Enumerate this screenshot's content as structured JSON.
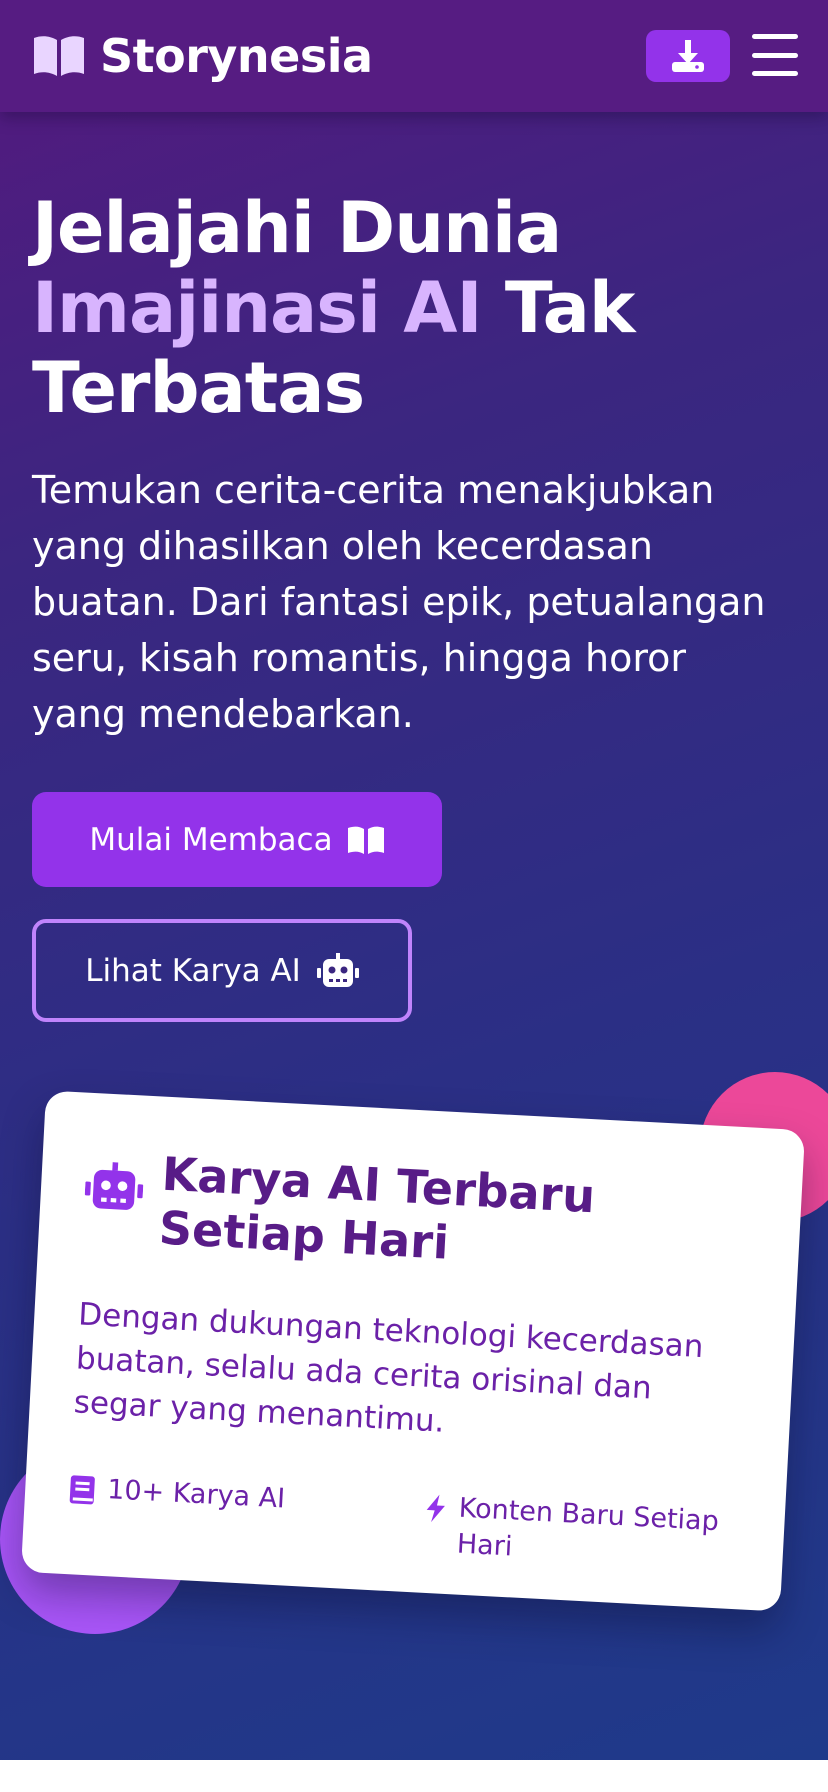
{
  "header": {
    "brand": "Storynesia",
    "logo_icon": "open-book-icon",
    "download_icon": "download-icon",
    "menu_icon": "hamburger-menu-icon"
  },
  "hero": {
    "headline_line1": "Jelajahi Dunia",
    "headline_accent": "Imajinasi AI",
    "headline_after_accent": " Tak",
    "headline_line3": "Terbatas",
    "lead": "Temukan cerita-cerita menakjubkan yang dihasilkan oleh kecerdasan buatan. Dari fantasi epik, petualangan seru, kisah romantis, hingga horor yang mendebarkan.",
    "primary_button": "Mulai Membaca",
    "primary_button_icon": "open-book-icon",
    "secondary_button": "Lihat Karya AI",
    "secondary_button_icon": "robot-icon"
  },
  "card": {
    "icon": "robot-icon",
    "title": "Karya AI Terbaru Setiap Hari",
    "description": "Dengan dukungan teknologi kecerdasan buatan, selalu ada cerita orisinal dan segar yang menantimu.",
    "stats": [
      {
        "icon": "book-icon",
        "label": "10+ Karya AI"
      },
      {
        "icon": "bolt-icon",
        "label": "Konten Baru Setiap Hari"
      }
    ]
  },
  "colors": {
    "header_bg": "#561c82",
    "accent_purple": "#9333ea",
    "accent_light": "#d8b4fe",
    "card_text": "#581c87",
    "deco_pink": "#ec4899",
    "deco_purple": "#a855f7"
  }
}
